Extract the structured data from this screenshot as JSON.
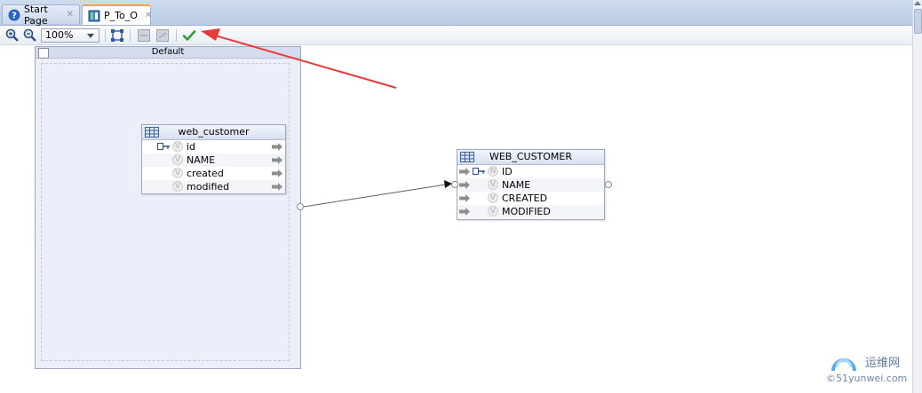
{
  "tabs": [
    {
      "label": "Start Page",
      "icon": "help-icon",
      "active": false
    },
    {
      "label": "P_To_O",
      "icon": "mapping-diagram-icon",
      "active": true
    }
  ],
  "toolbar": {
    "zoom_value": "100%"
  },
  "schema": {
    "title": "Default"
  },
  "source_table": {
    "name": "web_customer",
    "columns": [
      {
        "name": "id",
        "key": true
      },
      {
        "name": "NAME",
        "key": false
      },
      {
        "name": "created",
        "key": false
      },
      {
        "name": "modified",
        "key": false
      }
    ]
  },
  "target_table": {
    "name": "WEB_CUSTOMER",
    "columns": [
      {
        "name": "ID",
        "key": true
      },
      {
        "name": "NAME",
        "key": false
      },
      {
        "name": "CREATED",
        "key": false
      },
      {
        "name": "MODIFIED",
        "key": false
      }
    ]
  },
  "watermark": {
    "text_top": "运维网",
    "text_bottom": "©51yunwei.com"
  },
  "colors": {
    "annotation_arrow": "#e83a3a",
    "check_green": "#2e9e2e"
  }
}
